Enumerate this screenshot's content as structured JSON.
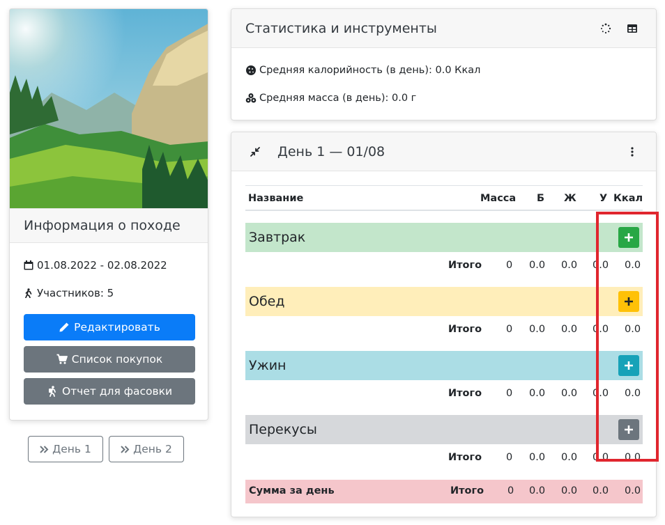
{
  "info": {
    "header": "Информация о походе",
    "dates": "01.08.2022 - 02.08.2022",
    "participants": "Участников: 5",
    "edit_label": "Редактировать",
    "shopping_label": "Список покупок",
    "packing_label": "Отчет для фасовки"
  },
  "day_nav": [
    "День 1",
    "День 2"
  ],
  "stats": {
    "title": "Статистика и инструменты",
    "calories": "Средняя калорийность (в день): 0.0 Ккал",
    "mass": "Средняя масса (в день): 0.0 г"
  },
  "day": {
    "title": "День 1 — 01/08",
    "columns": [
      "Название",
      "Масса",
      "Б",
      "Ж",
      "У",
      "Ккал"
    ],
    "meals": [
      {
        "name": "Завтрак",
        "total_label": "Итого",
        "values": [
          "0",
          "0.0",
          "0.0",
          "0.0",
          "0.0"
        ],
        "bg": "#c3e6cb",
        "btn": "#28a745"
      },
      {
        "name": "Обед",
        "total_label": "Итого",
        "values": [
          "0",
          "0.0",
          "0.0",
          "0.0",
          "0.0"
        ],
        "bg": "#ffeeba",
        "btn": "#ffc107"
      },
      {
        "name": "Ужин",
        "total_label": "Итого",
        "values": [
          "0",
          "0.0",
          "0.0",
          "0.0",
          "0.0"
        ],
        "bg": "#abdde5",
        "btn": "#17a2b8"
      },
      {
        "name": "Перекусы",
        "total_label": "Итого",
        "values": [
          "0",
          "0.0",
          "0.0",
          "0.0",
          "0.0"
        ],
        "bg": "#d6d8db",
        "btn": "#6c757d"
      }
    ],
    "sum": {
      "label": "Сумма за день",
      "total_label": "Итого",
      "values": [
        "0",
        "0.0",
        "0.0",
        "0.0",
        "0.0"
      ]
    }
  },
  "colors": {
    "primary": "#0a7cf8",
    "secondary": "#6c757d",
    "highlight": "#e0262e"
  }
}
